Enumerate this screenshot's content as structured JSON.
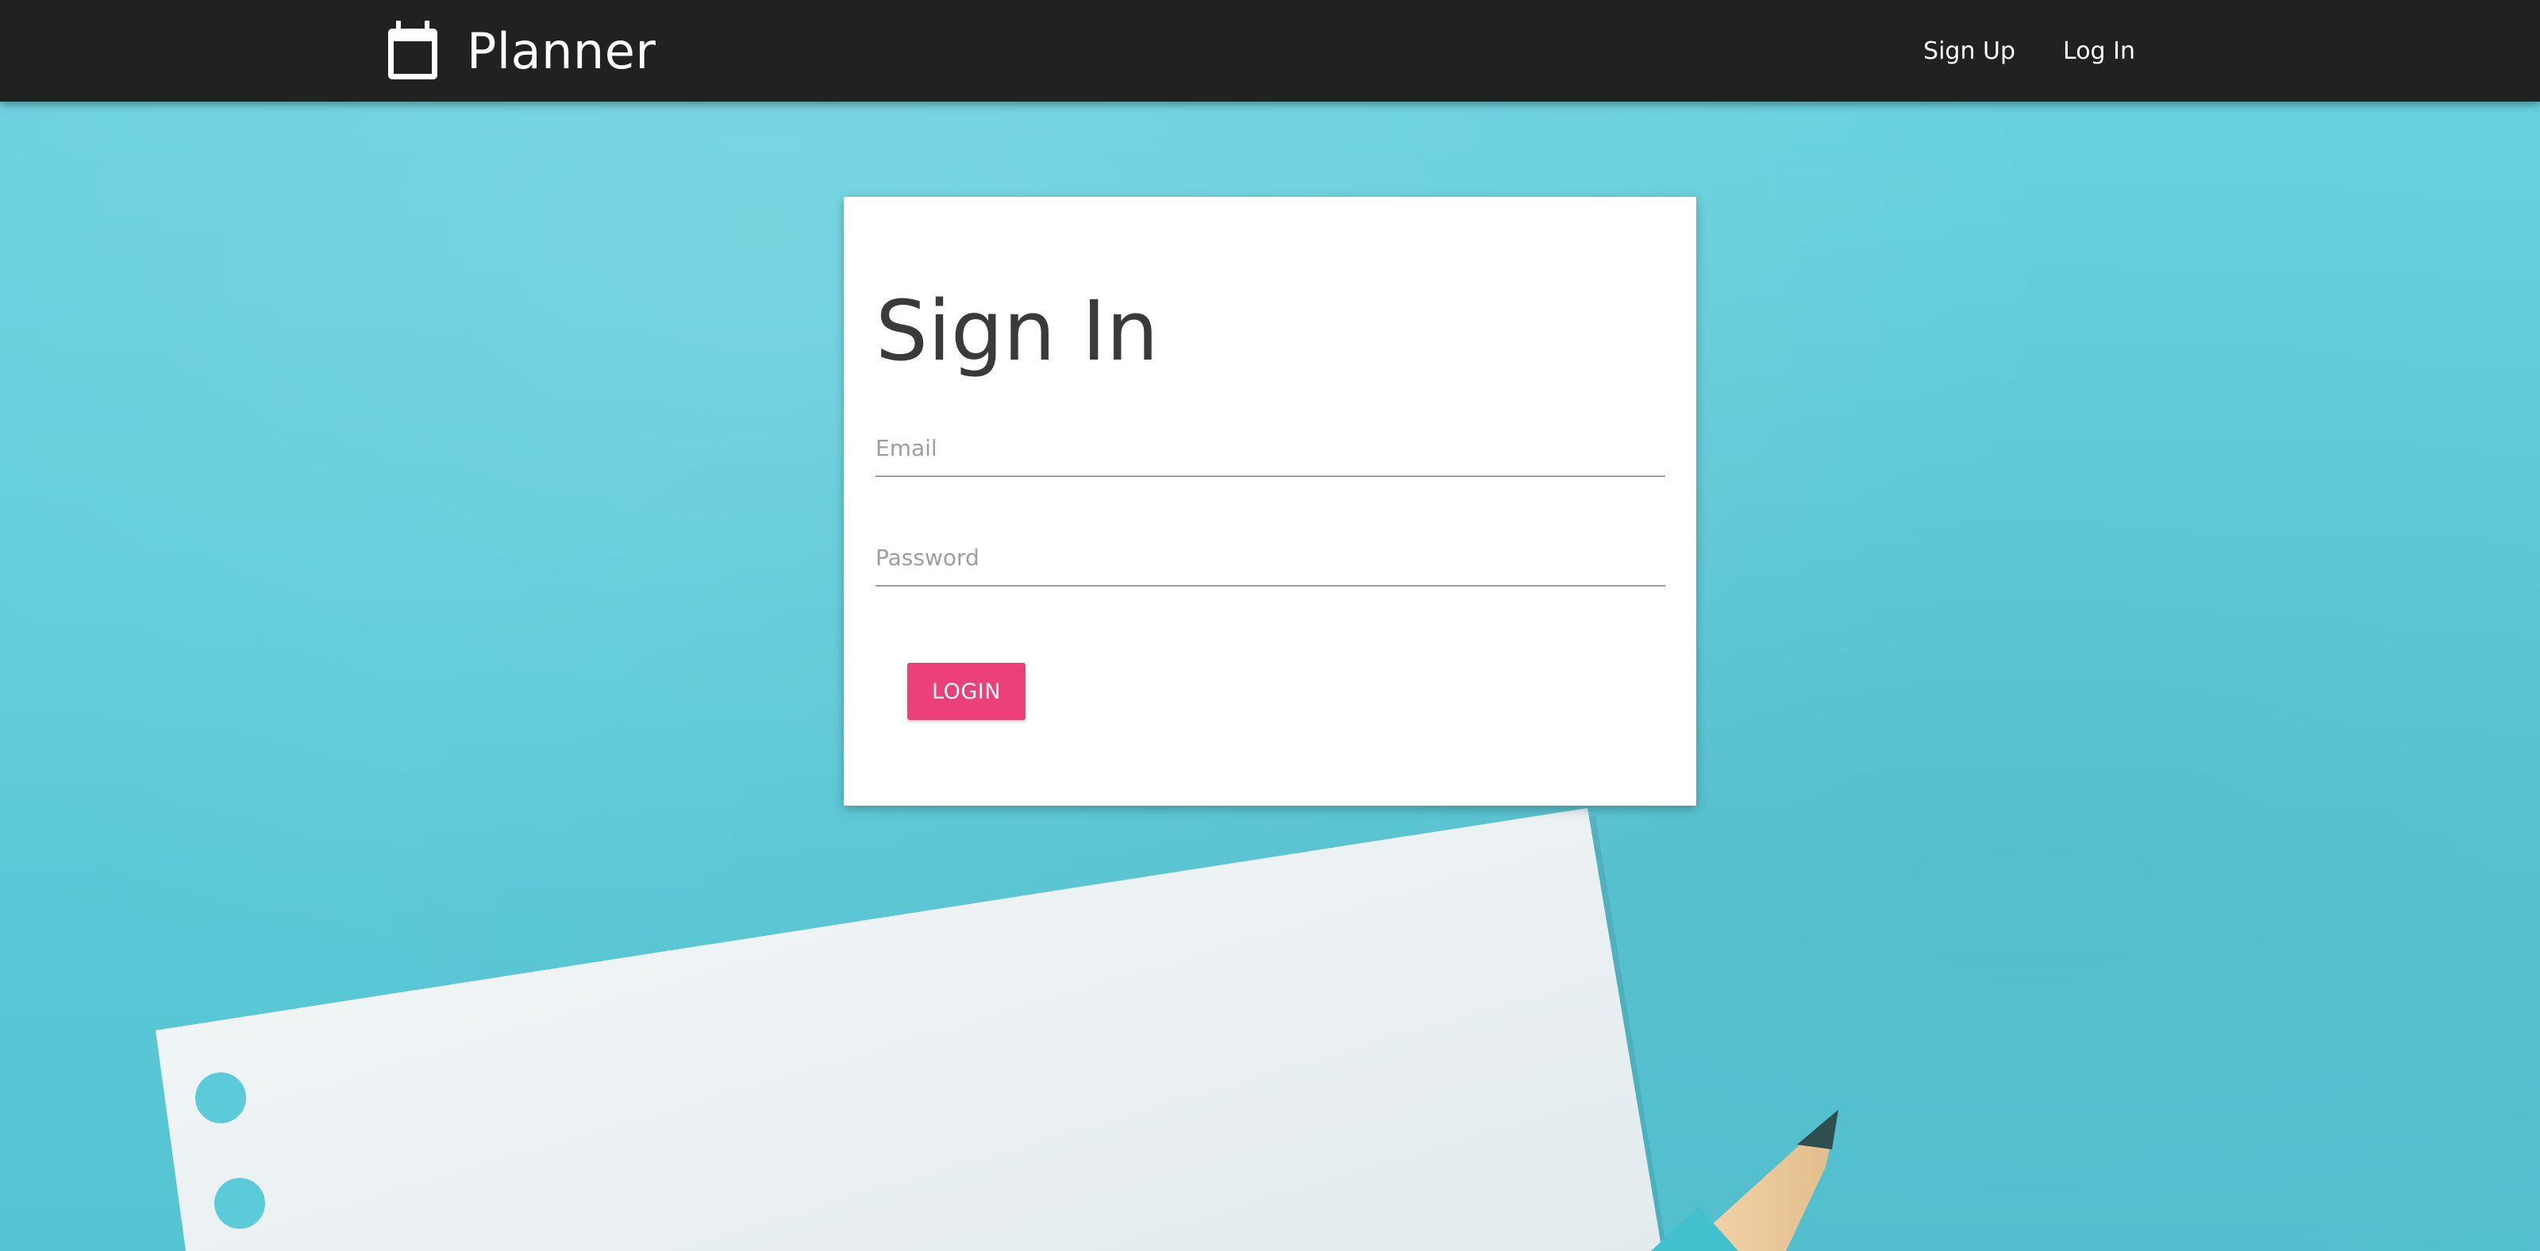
{
  "navbar": {
    "brand_title": "Planner",
    "brand_icon": "calendar-icon",
    "links": [
      {
        "label": "Sign Up"
      },
      {
        "label": "Log In"
      }
    ]
  },
  "signin": {
    "title": "Sign In",
    "email_placeholder": "Email",
    "email_value": "",
    "password_placeholder": "Password",
    "password_value": "",
    "login_label": "LOGIN"
  },
  "colors": {
    "navbar_bg": "#212121",
    "background": "#5ccbd9",
    "login_button": "#ec407a"
  }
}
